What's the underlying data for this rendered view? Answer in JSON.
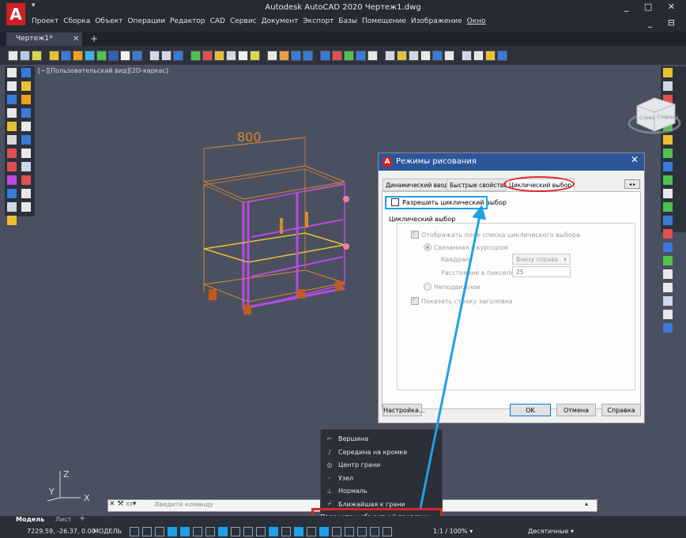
{
  "app": {
    "logo": "A",
    "title": "Autodesk AutoCAD 2020   Чертеж1.dwg",
    "menu": [
      "Проект",
      "Сборка",
      "Объект",
      "Операции",
      "Редактор",
      "CAD",
      "Сервис",
      "Документ",
      "Экспорт",
      "Базы",
      "Помещение",
      "Изображение",
      "Окно"
    ],
    "window_controls": "_ □ ✕",
    "doc_controls": "_ ⊟"
  },
  "doc_tab": {
    "label": "Чертеж1*",
    "close": "✕",
    "new": "+"
  },
  "viewport": {
    "label": "[−][Пользовательский вид][2D-каркас]",
    "dimension": "800"
  },
  "viewcube": {
    "label_left": "Слева",
    "label_front": "Спереди"
  },
  "dialog": {
    "logo": "A",
    "title": "Режимы рисования",
    "close": "✕",
    "tabs": [
      "Динамический ввод",
      "Быстрые свойства",
      "Циклический выбор"
    ],
    "tab_scroll": "◂ ▸",
    "enable_cycling": "Разрешить циклический выбор",
    "group_title": "Циклический выбор",
    "show_list": "Отображать поле списка циклического выбора",
    "linked_cursor": "Связанная с курсором",
    "quadrant_label": "Квадрант",
    "quadrant_value": "Внизу справа",
    "distance_label": "Расстояние в пикселах",
    "distance_value": "25",
    "static": "Неподвижное",
    "show_title": "Показать строку заголовка",
    "btn_settings": "Настройка...",
    "btn_ok": "OK",
    "btn_cancel": "Отмена",
    "btn_help": "Справка"
  },
  "context_menu": {
    "items": [
      {
        "icon": "vertex-icon",
        "glyph": "⌐",
        "label": "Вершина"
      },
      {
        "icon": "edge-midpoint-icon",
        "glyph": "∕",
        "label": "Середина на кромке"
      },
      {
        "icon": "face-center-icon",
        "glyph": "◎",
        "label": "Центр грани"
      },
      {
        "icon": "node-icon",
        "glyph": "◦",
        "label": "Узел"
      },
      {
        "icon": "perpendicular-icon",
        "glyph": "⊥",
        "label": "Нормаль"
      },
      {
        "icon": "nearest-face-icon",
        "glyph": "⌿",
        "label": "Ближайшая к грани"
      }
    ],
    "settings": "Параметры объектной привязки..."
  },
  "command": {
    "tools": "✕ ⚒ ▭▾",
    "placeholder": "Введите команду",
    "up": "▴"
  },
  "ucs": {
    "x": "X",
    "y": "Y",
    "z": "Z"
  },
  "layout_tabs": {
    "model": "Модель",
    "sheet": "Лист",
    "add": "+"
  },
  "status": {
    "coords": "7229.59, -26.37, 0.00",
    "model": "МОДЕЛЬ",
    "scale": "1:1 / 100% ▾",
    "units": "Десятичные ▾"
  },
  "colors": {
    "accent_blue": "#1ea0e6",
    "annotation_red": "#e0262f",
    "cabinet_orange": "#d8892f",
    "cabinet_purple": "#b84ae0"
  }
}
